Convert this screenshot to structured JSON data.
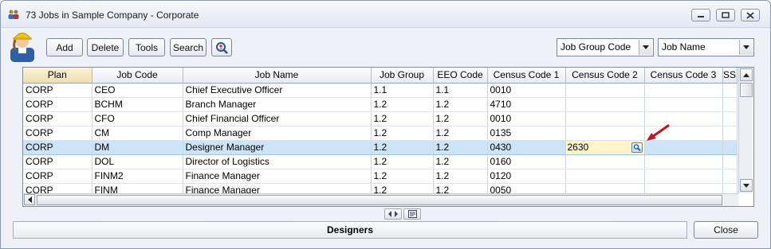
{
  "window": {
    "title": "73 Jobs in Sample Company - Corporate",
    "controls": {
      "minimize": "minimize",
      "maximize": "maximize",
      "close": "close"
    }
  },
  "toolbar": {
    "add_label": "Add",
    "delete_label": "Delete",
    "tools_label": "Tools",
    "search_label": "Search",
    "find_icon": "find-person-icon",
    "group_select_value": "Job Group Code",
    "name_select_value": "Job Name"
  },
  "grid": {
    "columns": [
      "Plan",
      "Job Code",
      "Job Name",
      "Job Group",
      "EEO Code",
      "Census Code 1",
      "Census Code 2",
      "Census Code 3",
      "SS"
    ],
    "rows": [
      [
        "CORP",
        "CEO",
        "Chief Executive Officer",
        "1.1",
        "1.1",
        "0010",
        "",
        "",
        ""
      ],
      [
        "CORP",
        "BCHM",
        "Branch Manager",
        "1.2",
        "1.2",
        "4710",
        "",
        "",
        ""
      ],
      [
        "CORP",
        "CFO",
        "Chief Financial Officer",
        "1.2",
        "1.2",
        "0010",
        "",
        "",
        ""
      ],
      [
        "CORP",
        "CM",
        "Comp Manager",
        "1.2",
        "1.2",
        "0135",
        "",
        "",
        ""
      ],
      [
        "CORP",
        "DM",
        "Designer Manager",
        "1.2",
        "1.2",
        "0430",
        "2630",
        "",
        ""
      ],
      [
        "CORP",
        "DOL",
        "Director of Logistics",
        "1.2",
        "1.2",
        "0160",
        "",
        "",
        ""
      ],
      [
        "CORP",
        "FINM2",
        "Finance Manager",
        "1.2",
        "1.2",
        "0120",
        "",
        "",
        ""
      ],
      [
        "CORP",
        "FINM",
        "Finance Manager",
        "1.2",
        "1.2",
        "0050",
        "",
        "",
        ""
      ]
    ],
    "selected_row": 4,
    "editing_column": 6
  },
  "status": {
    "text": "Designers"
  },
  "footer": {
    "close_label": "Close"
  },
  "colors": {
    "selection": "#cde3f8",
    "editing": "#fff5c8",
    "pointer": "#c0141c"
  }
}
